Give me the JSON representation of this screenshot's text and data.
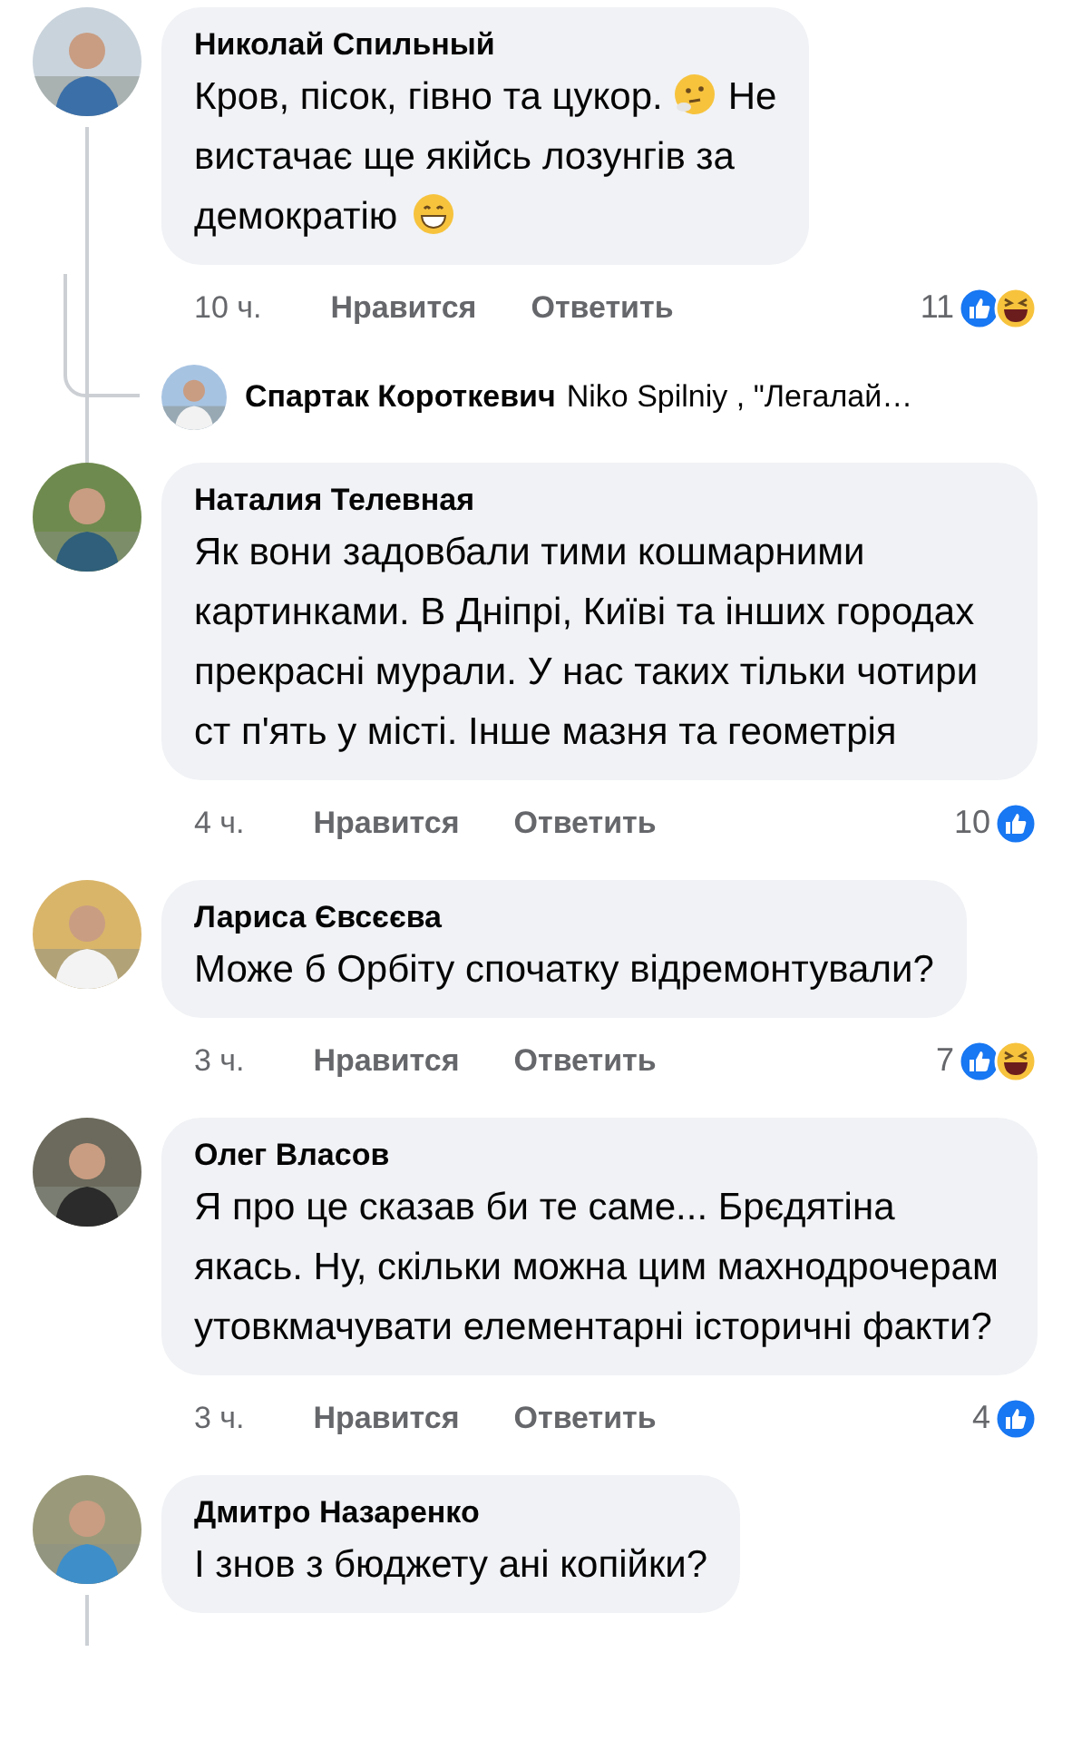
{
  "comments": [
    {
      "author": "Николай Спильный",
      "avatar": {
        "kind": "picture"
      },
      "thread": true,
      "parts": [
        {
          "kind": "text",
          "text": "Кров, пісок, гівно та цукор."
        },
        {
          "kind": "thinking-emoji"
        },
        {
          "kind": "text",
          "text": "Не"
        },
        {
          "kind": "line",
          "text": "вистачає ще якійсь лозунгів за"
        },
        {
          "kind": "line",
          "text": "демократію"
        },
        {
          "kind": "grin-emoji"
        }
      ],
      "time": "10 ч.",
      "like": "Нравится",
      "reply": "Ответить",
      "count": "11",
      "reactions": [
        {
          "kind": "like"
        },
        {
          "kind": "haha"
        }
      ],
      "replies": [
        {
          "author": "Спартак Короткевич",
          "text": "Niko  Spilniy , \"Легалай…"
        }
      ]
    },
    {
      "author": "Наталия Телевная",
      "avatar": {
        "kind": "picture"
      },
      "thread": false,
      "parts": [
        {
          "kind": "text",
          "text": "Як вони задовбали тими кошмарними картинками. В Дніпрі, Київі та інших городах прекрасні мурали. У нас таких тільки чотири ст п'ять у місті. Інше мазня та геометрія"
        }
      ],
      "time": "4 ч.",
      "like": "Нравится",
      "reply": "Ответить",
      "count": "10",
      "reactions": [
        {
          "kind": "like"
        }
      ]
    },
    {
      "author": "Лариса Євсєєва",
      "avatar": {
        "kind": "picture"
      },
      "thread": false,
      "parts": [
        {
          "kind": "text",
          "text": "Може б Орбіту спочатку відремонтували?"
        }
      ],
      "time": "3 ч.",
      "like": "Нравится",
      "reply": "Ответить",
      "count": "7",
      "reactions": [
        {
          "kind": "like"
        },
        {
          "kind": "haha"
        }
      ]
    },
    {
      "author": "Олег Власов",
      "avatar": {
        "kind": "picture"
      },
      "thread": false,
      "parts": [
        {
          "kind": "text",
          "text": "Я про це сказав би те саме... Брєдятіна якась. Ну, скільки можна цим махнодрочерам утовкмачувати елементарні історичні факти?"
        }
      ],
      "time": "3 ч.",
      "like": "Нравится",
      "reply": "Ответить",
      "count": "4",
      "reactions": [
        {
          "kind": "like"
        }
      ]
    },
    {
      "author": "Дмитро Назаренко",
      "avatar": {
        "kind": "picture"
      },
      "thread": true,
      "parts": [
        {
          "kind": "text",
          "text": "І знов з бюджету ані копійки?"
        }
      ]
    }
  ]
}
